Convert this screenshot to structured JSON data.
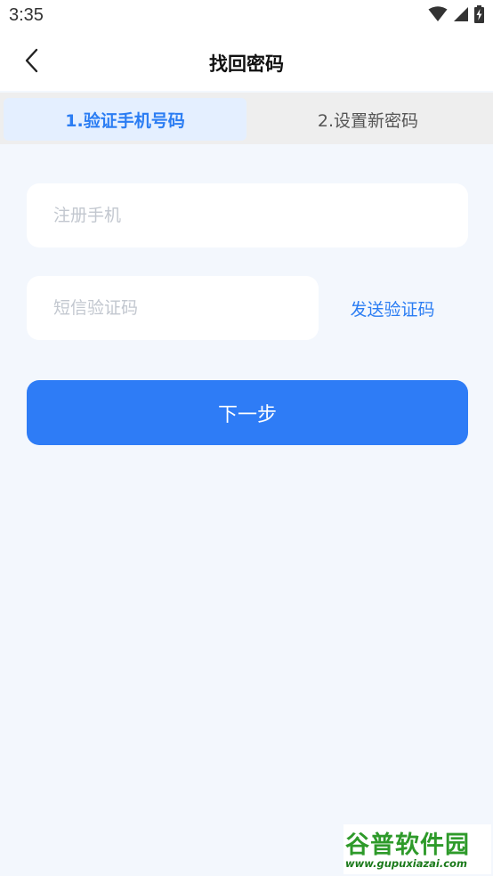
{
  "status_bar": {
    "time": "3:35",
    "icons": [
      "wifi-icon",
      "signal-icon",
      "battery-charging-icon"
    ]
  },
  "header": {
    "title": "找回密码",
    "back_icon": "chevron-left-icon"
  },
  "tabs": [
    {
      "label": "1.验证手机号码",
      "active": true
    },
    {
      "label": "2.设置新密码",
      "active": false
    }
  ],
  "form": {
    "phone_placeholder": "注册手机",
    "phone_value": "",
    "sms_placeholder": "短信验证码",
    "sms_value": "",
    "send_code_label": "发送验证码",
    "next_label": "下一步"
  },
  "watermark": {
    "title": "谷普软件园",
    "url": "www.gupuxiazai.com"
  },
  "colors": {
    "accent": "#2e7cf6",
    "accent_text": "#2b7df3",
    "background": "#f3f7fd",
    "tab_active_bg": "#e4efff",
    "watermark_green": "#2e9a2a"
  }
}
